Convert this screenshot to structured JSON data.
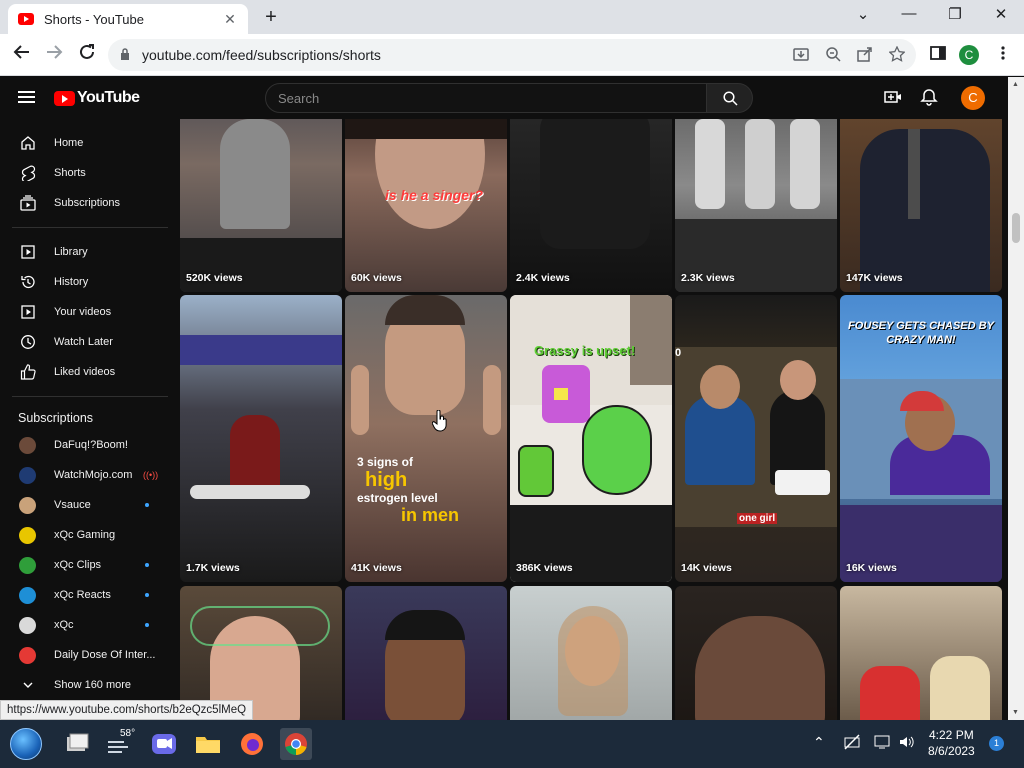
{
  "browser": {
    "tab_title": "Shorts - YouTube",
    "tab_close": "✕",
    "new_tab": "+",
    "window_controls": {
      "collapse": "⌄",
      "minimize": "—",
      "restore": "❐",
      "close": "✕"
    },
    "url": "youtube.com/feed/subscriptions/shorts",
    "profile_initial": "C",
    "status_url": "https://www.youtube.com/shorts/b2eQzc5lMeQ"
  },
  "youtube": {
    "logo_text": "YouTube",
    "search_placeholder": "Search",
    "avatar_initial": "C",
    "nav_primary": [
      {
        "label": "Home",
        "icon": "home-icon"
      },
      {
        "label": "Shorts",
        "icon": "shorts-icon"
      },
      {
        "label": "Subscriptions",
        "icon": "subscriptions-icon"
      }
    ],
    "nav_library": [
      {
        "label": "Library",
        "icon": "library-icon"
      },
      {
        "label": "History",
        "icon": "history-icon"
      },
      {
        "label": "Your videos",
        "icon": "your-videos-icon"
      },
      {
        "label": "Watch Later",
        "icon": "watch-later-icon"
      },
      {
        "label": "Liked videos",
        "icon": "liked-videos-icon"
      }
    ],
    "subscriptions_heading": "Subscriptions",
    "subscriptions": [
      {
        "label": "DaFuq!?Boom!",
        "indicator": "none",
        "color": "#6b4a3a"
      },
      {
        "label": "WatchMojo.com",
        "indicator": "live",
        "color": "#1f3b73"
      },
      {
        "label": "Vsauce",
        "indicator": "new",
        "color": "#c9a27a"
      },
      {
        "label": "xQc Gaming",
        "indicator": "none",
        "color": "#e8c600"
      },
      {
        "label": "xQc Clips",
        "indicator": "new",
        "color": "#2f9e3a"
      },
      {
        "label": "xQc Reacts",
        "indicator": "new",
        "color": "#1e8fd6"
      },
      {
        "label": "xQc",
        "indicator": "new",
        "color": "#d9d9d9"
      },
      {
        "label": "Daily Dose Of Inter...",
        "indicator": "none",
        "color": "#e53935"
      }
    ],
    "show_more": "Show 160 more",
    "shorts_rows": [
      [
        {
          "views": "520K views"
        },
        {
          "views": "60K views",
          "overlay": "is he a singer?"
        },
        {
          "views": "2.4K views"
        },
        {
          "views": "2.3K views"
        },
        {
          "views": "147K views"
        }
      ],
      [
        {
          "views": "1.7K views"
        },
        {
          "views": "41K views",
          "overlay_lines": [
            "3 signs of",
            "high",
            "estrogen level",
            "in men"
          ]
        },
        {
          "views": "386K views",
          "overlay": "Grassy is upset!"
        },
        {
          "views": "14K views",
          "overlay": "one girl",
          "side_label": "0"
        },
        {
          "views": "16K views",
          "overlay_lines": [
            "FOUSEY GETS CHASED BY",
            "CRAZY MAN!"
          ]
        }
      ],
      [
        {
          "views": ""
        },
        {
          "views": ""
        },
        {
          "views": ""
        },
        {
          "views": ""
        },
        {
          "views": ""
        }
      ]
    ]
  },
  "taskbar": {
    "temperature": "58°",
    "time": "4:22 PM",
    "date": "8/6/2023",
    "notification_count": "1"
  },
  "colors": {
    "yt_background": "#0f0f0f",
    "yt_red": "#ff0000",
    "chrome_frame": "#dee1e6",
    "taskbar": "#1c2a3a"
  }
}
